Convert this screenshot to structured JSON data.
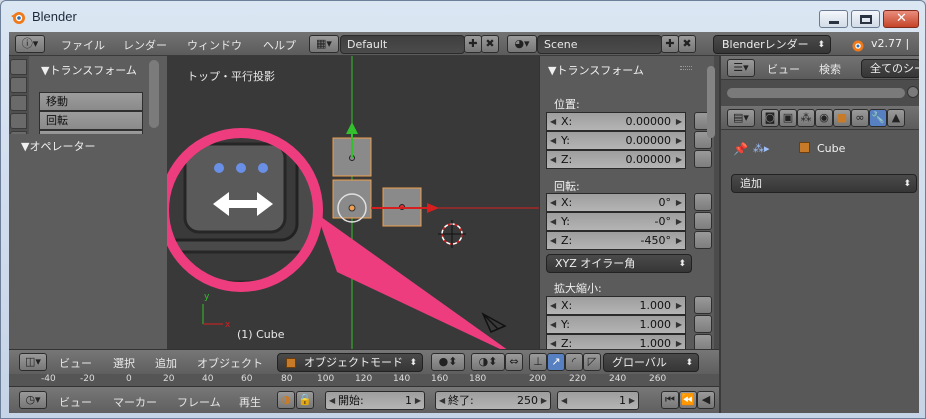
{
  "window": {
    "title": "Blender"
  },
  "info_header": {
    "menus": [
      "ファイル",
      "レンダー",
      "ウィンドウ",
      "ヘルプ"
    ],
    "layout": "Default",
    "scene": "Scene",
    "engine": "Blenderレンダー",
    "version": "v2.77 | "
  },
  "tool_shelf": {
    "transform_title": "▼トランスフォーム",
    "move": "移動",
    "rotate": "回転",
    "operator_title": "▼オペレーター"
  },
  "viewport": {
    "view_label": "トップ・平行投影",
    "object_label": "(1) Cube"
  },
  "n_panel": {
    "title": "▼トランスフォーム",
    "location_label": "位置:",
    "location": [
      {
        "axis": "X:",
        "value": "0.00000"
      },
      {
        "axis": "Y:",
        "value": "0.00000"
      },
      {
        "axis": "Z:",
        "value": "0.00000"
      }
    ],
    "rotation_label": "回転:",
    "rotation": [
      {
        "axis": "X:",
        "value": "0°"
      },
      {
        "axis": "Y:",
        "value": "-0°"
      },
      {
        "axis": "Z:",
        "value": "-450°"
      }
    ],
    "rotation_mode": "XYZ オイラー角",
    "scale_label": "拡大縮小:",
    "scale": [
      {
        "axis": "X:",
        "value": "1.000"
      },
      {
        "axis": "Y:",
        "value": "1.000"
      },
      {
        "axis": "Z:",
        "value": "1.000"
      }
    ]
  },
  "viewport_header": {
    "menus": [
      "ビュー",
      "選択",
      "追加",
      "オブジェクト"
    ],
    "mode": "オブジェクトモード",
    "orientation": "グローバル"
  },
  "timeline_ruler": {
    "ticks": [
      "-40",
      "-20",
      "0",
      "20",
      "40",
      "60",
      "80",
      "100",
      "120",
      "140",
      "160",
      "180",
      "200",
      "220",
      "240",
      "260"
    ]
  },
  "timeline_header": {
    "menus": [
      "ビュー",
      "マーカー",
      "フレーム",
      "再生"
    ],
    "start_label": "開始:",
    "start_value": "1",
    "end_label": "終了:",
    "end_value": "250",
    "current_frame": "1"
  },
  "properties": {
    "menus": [
      "ビュー",
      "検索"
    ],
    "filter": "全てのシー",
    "breadcrumb_object": "Cube",
    "add_dropdown": "追加"
  },
  "colors": {
    "accent_pink": "#ee3d7f",
    "x_axis": "#d81f1f",
    "y_axis": "#32c12c",
    "selection_orange": "#f0a050",
    "active_blue": "#5680c2"
  }
}
